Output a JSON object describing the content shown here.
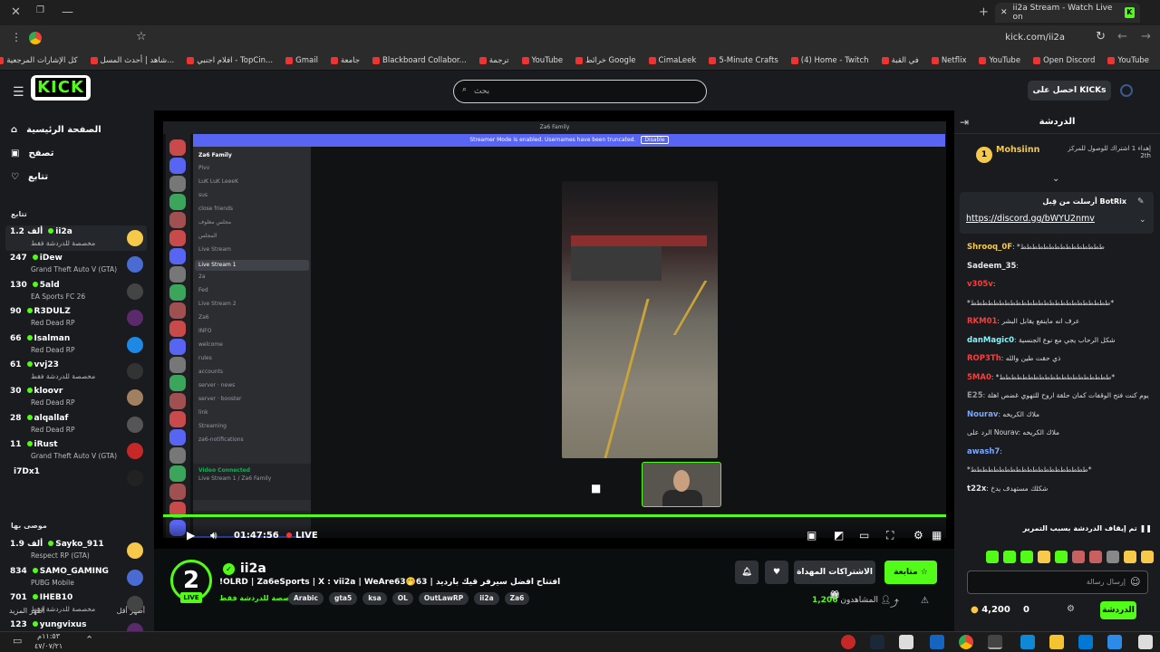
{
  "browser": {
    "tab_title": "ii2a Stream - Watch Live on",
    "url": "kick.com/ii2a",
    "bookmarks": [
      "YouTube",
      "Open Discord",
      "YouTube",
      "Netflix",
      "في القبة",
      "(4) Home - Twitch",
      "5-Minute Crafts",
      "CimaLeek",
      "خرائط Google",
      "YouTube",
      "ترجمة",
      "Blackboard Collabor...",
      "جامعة",
      "Gmail",
      "افلام اجنبي - TopCin...",
      "شاهد | أحدث المسل...",
      "كل الإشارات المرجعية"
    ]
  },
  "header": {
    "logo": "KICK",
    "logo_badge": "BETA",
    "search_placeholder": "بحث",
    "get_kicks": "احصل على KICKs"
  },
  "sidebar": {
    "nav": [
      "الصفحة الرئيسية",
      "تصفح",
      "تتابع"
    ],
    "following_title": "تتابع",
    "channels": [
      {
        "name": "ii2a",
        "count": "1.2 ألف",
        "category": "مخصصة للدردشة فقط"
      },
      {
        "name": "iDew",
        "count": "247",
        "category": "Grand Theft Auto V (GTA)"
      },
      {
        "name": "5ald",
        "count": "130",
        "category": "EA Sports FC 26"
      },
      {
        "name": "R3DULZ",
        "count": "90",
        "category": "Red Dead RP"
      },
      {
        "name": "Isalman",
        "count": "66",
        "category": "Red Dead RP"
      },
      {
        "name": "vvj23",
        "count": "61",
        "category": "مخصصة للدردشة فقط"
      },
      {
        "name": "kloovr",
        "count": "30",
        "category": "Red Dead RP"
      },
      {
        "name": "alqallaf",
        "count": "28",
        "category": "Red Dead RP"
      },
      {
        "name": "iRust",
        "count": "11",
        "category": "Grand Theft Auto V (GTA)"
      },
      {
        "name": "i7Dx1",
        "count": "",
        "category": ""
      }
    ],
    "show_more": "أظهر المزيد",
    "show_less": "أظهر أقل",
    "recommended_title": "موصى بها",
    "recommended": [
      {
        "name": "Sayko_911",
        "count": "1.9 ألف",
        "category": "Respect RP (GTA)"
      },
      {
        "name": "SAMO_GAMING",
        "count": "834",
        "category": "PUBG Mobile"
      },
      {
        "name": "IHEB10",
        "count": "701",
        "category": "مخصصة للدردشة فقط"
      },
      {
        "name": "yungvixus",
        "count": "123",
        "category": ""
      }
    ]
  },
  "video": {
    "discord_server": "Za6 Family",
    "banner": "Streamer Mode is enabled. Usernames have been truncated.",
    "banner_btn": "Disable",
    "channels": [
      "Pivv",
      "LuK LuK LeeeK",
      "sus",
      "close friends",
      "مجلس مغلوف",
      "المجلس",
      "Live Stream",
      "Live Stream 1",
      "2a",
      "Fed",
      "Live Stream 2",
      "Za6",
      "INFO",
      "welcome",
      "rules",
      "accounts",
      "server · news",
      "server · booster",
      "link",
      "Streaming",
      "za6-notifications"
    ],
    "voice_status": "Video Connected",
    "voice_sub": "Live Stream 1 / Za6 Family",
    "time": "01:47:56",
    "live": "LIVE"
  },
  "stream": {
    "name": "ii2a",
    "title": "!OLRD | Za6eSports | X : vii2a | WeAre63🤭63 | افتتاح افضل سيرفر قيك بارديد",
    "category": "مخصصة للدردشة فقط",
    "tags": [
      "Arabic",
      "gta5",
      "ksa",
      "OL",
      "OutLawRP",
      "ii2a",
      "Za6"
    ],
    "follow": "متابعة",
    "subs_gift": "الاشتراكات المهداة",
    "viewers_label": "المشاهدون",
    "viewers": "1,206",
    "avatar_letter": "2",
    "live_badge": "LIVE"
  },
  "chat": {
    "title": "الدردشة",
    "pinned_user": "Mohsiinn",
    "pinned_rank": "1",
    "pinned_text": "إهداء 1 اشتراك للوصول للمركز 2th",
    "bot_header": "أرسلت من قِبل BotRix",
    "bot_name": "BotRix",
    "bot_link": "https://discord.gg/bWYU2nmv",
    "messages": [
      {
        "user": "Shrooq_0F",
        "text": "*ططططططططططططططط",
        "color": "#f7c94b"
      },
      {
        "user": "Sadeem_35",
        "text": "",
        "color": "#e6e6e6"
      },
      {
        "user": "v305v",
        "text": "",
        "color": "#ff3b3b"
      },
      {
        "user": "",
        "text": "*ططططططططططططططططططططططططط*",
        "color": "#e6e6e6"
      },
      {
        "user": "RKM01",
        "text": "عرف انه ماينفع يقابل البشر",
        "color": "#ff3b3b"
      },
      {
        "user": "danMagic0",
        "text": "شكل الرحاب يجي مع نوع الجنسية",
        "color": "#7ff6ff"
      },
      {
        "user": "ROP3Th",
        "text": "ذي حقت طين والله",
        "color": "#ff3b3b"
      },
      {
        "user": "5MA0",
        "text": "*طططططططططططططططططططط*",
        "color": "#ff3b3b"
      },
      {
        "user": "E25",
        "text": "يوم كنت فتح الوقفات كمان حلقة اروح للتهوي غضص اهلة",
        "color": "#999"
      },
      {
        "user": "Nourav",
        "text": "ملاك الكريخه",
        "color": "#7aa7ff"
      },
      {
        "user": "",
        "text": "الرد على Nourav: ملاك الكريخه",
        "color": "#999"
      },
      {
        "user": "awash7",
        "text": "",
        "color": "#7aa7ff"
      },
      {
        "user": "",
        "text": "*ططططططططططططططططططططط*",
        "color": "#e6e6e6"
      },
      {
        "user": "t22x",
        "text": "شكلك مستهدف يدخ",
        "color": "#e6e6e6"
      }
    ],
    "paused": "تم إيقاف الدردشة بسبب التمرير",
    "input_placeholder": "إرسال رسالة",
    "kicks_balance": "4,200",
    "zero": "0",
    "send": "الدردشة"
  },
  "taskbar": {
    "time": "١١:٥٣م",
    "date": "٤٧/٠٧/٢١"
  }
}
